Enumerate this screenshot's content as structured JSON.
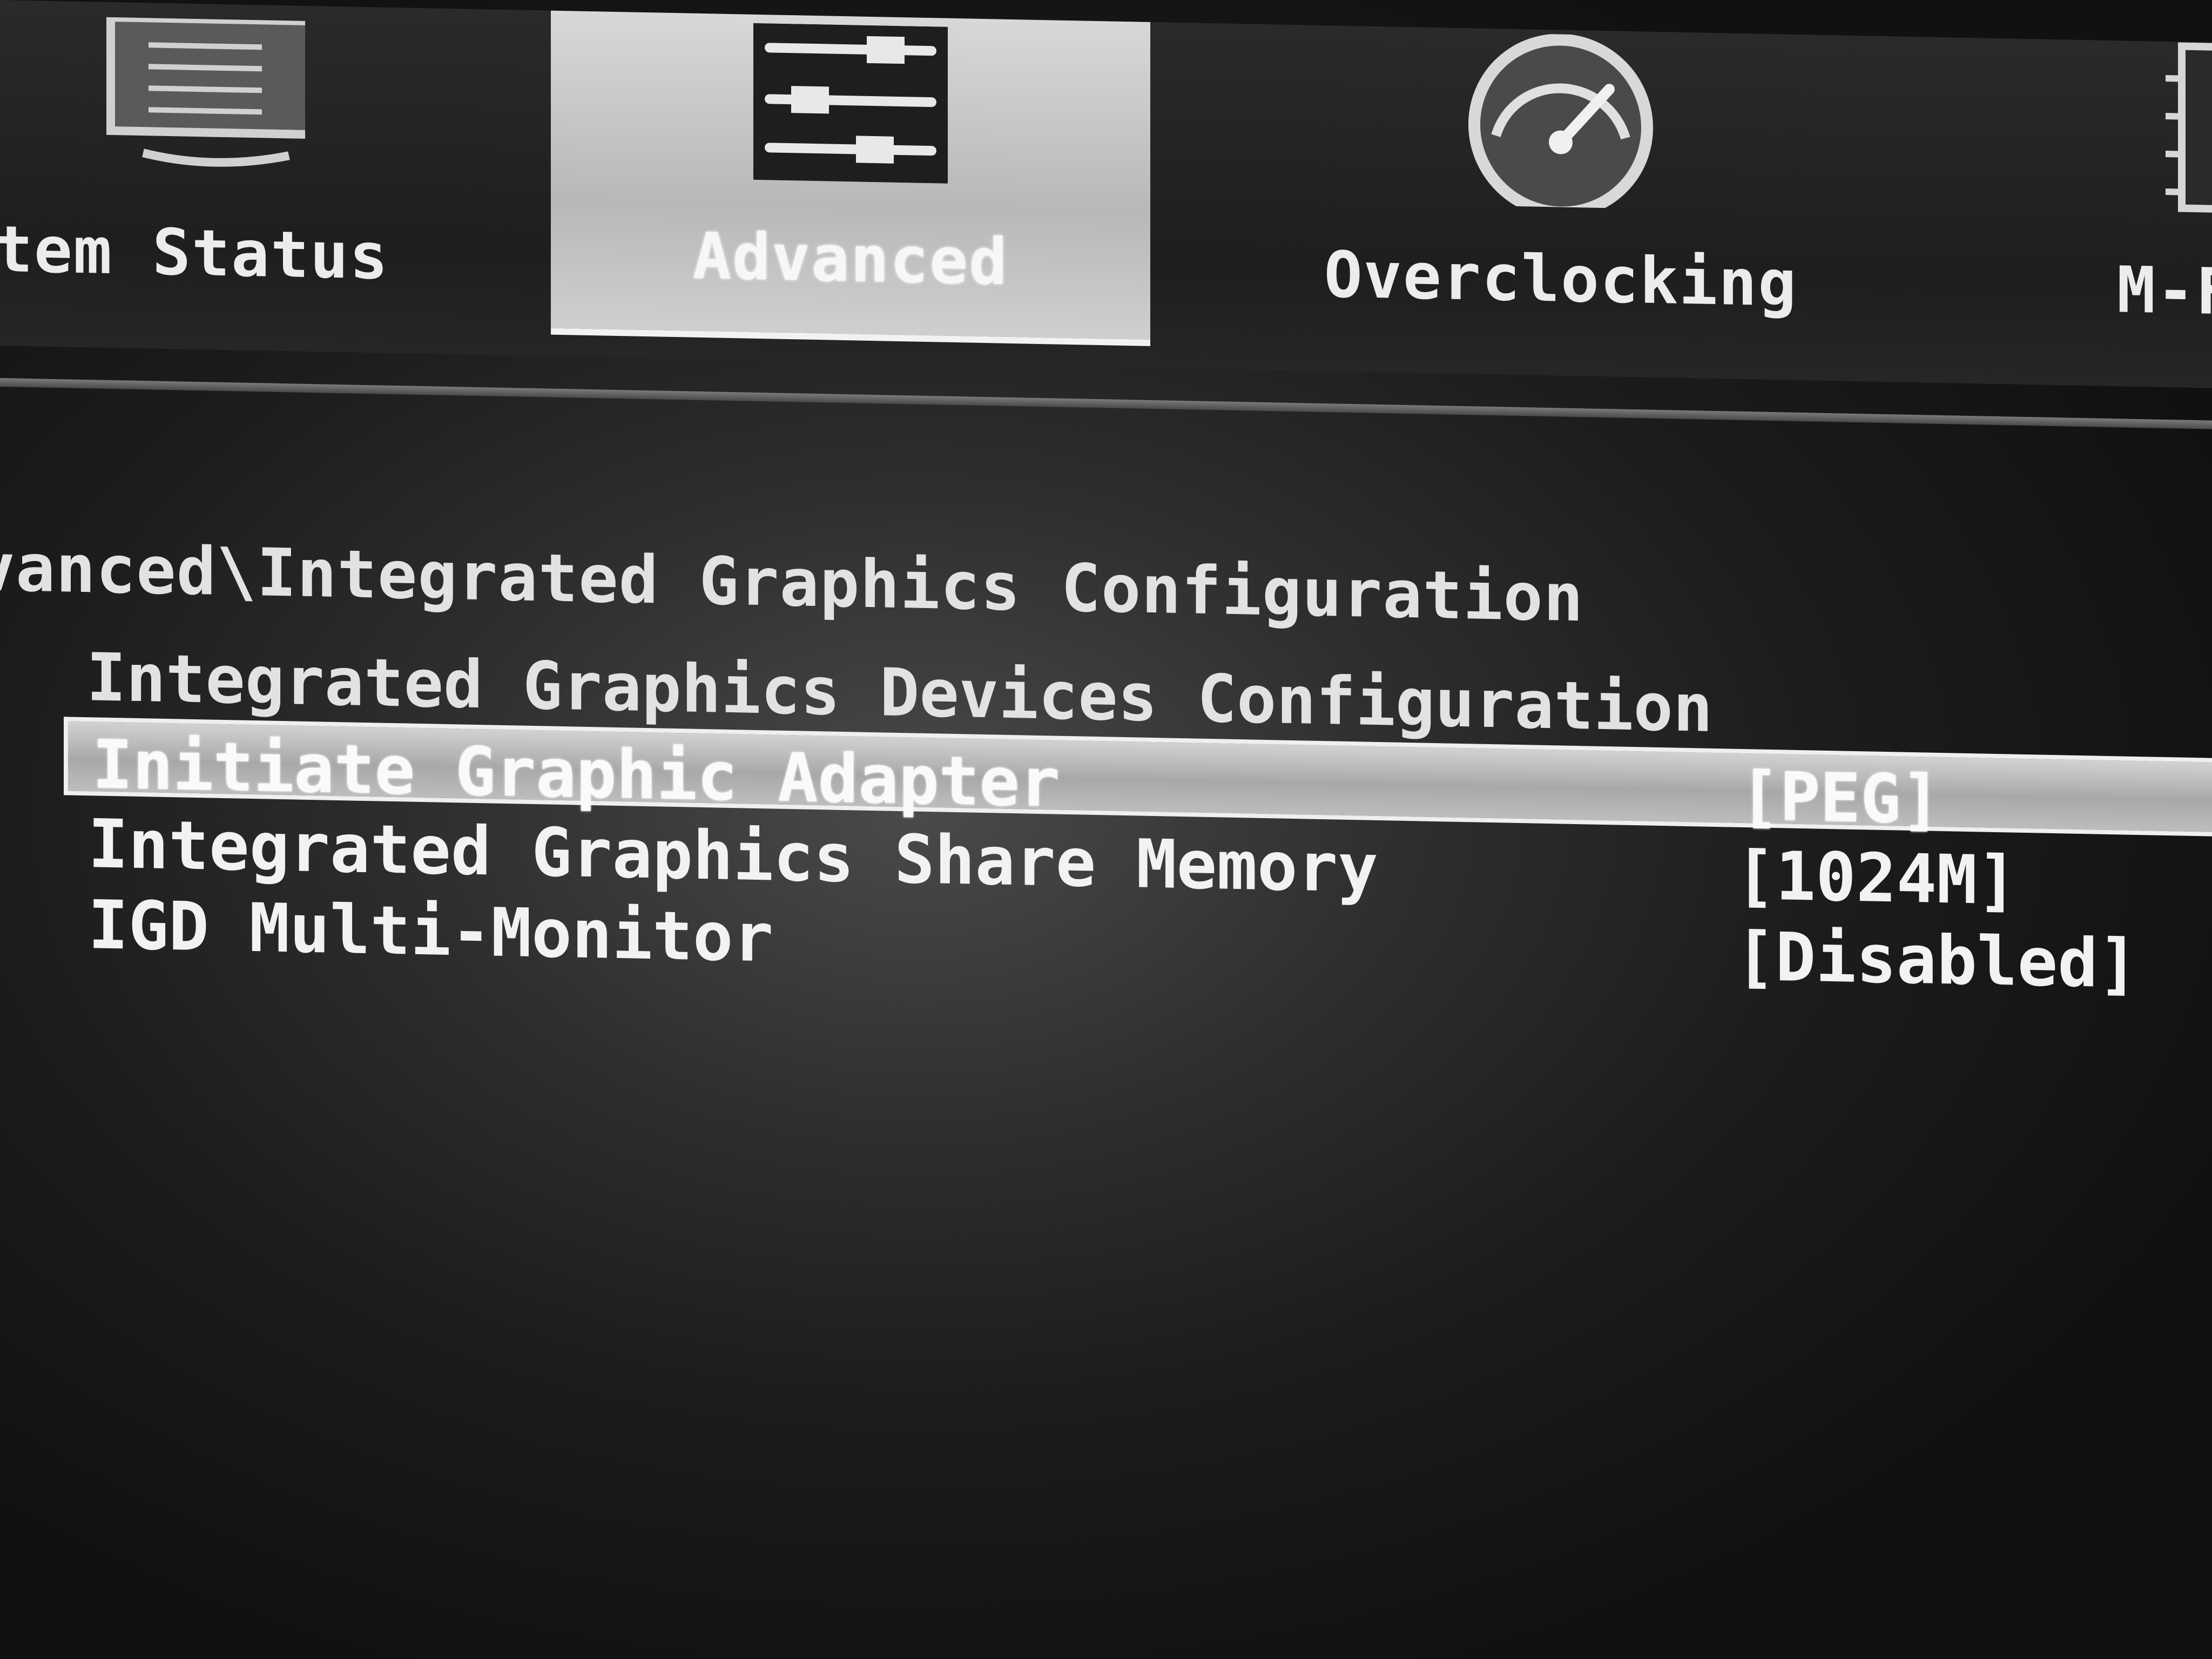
{
  "tabs": [
    {
      "label": "tem Status",
      "icon": "monitor-icon"
    },
    {
      "label": "Advanced",
      "icon": "settings-sliders-icon",
      "active": true
    },
    {
      "label": "Overclocking",
      "icon": "speedometer-icon"
    },
    {
      "label": "M-F",
      "icon": "chip-icon"
    }
  ],
  "breadcrumb": "dvanced\\Integrated Graphics Configuration",
  "section_title": "Integrated Graphics Devices Configuration",
  "settings": [
    {
      "label": "Initiate Graphic Adapter",
      "value": "[PEG]",
      "selected": true
    },
    {
      "label": "Integrated Graphics Share Memory",
      "value": "[1024M]"
    },
    {
      "label": "IGD Multi-Monitor",
      "value": "[Disabled]"
    }
  ],
  "colors": {
    "background": "#1c1c1c",
    "tab_active": "#c4c4c4",
    "text": "#e6e6e6",
    "selection": "#b5b5b5"
  }
}
